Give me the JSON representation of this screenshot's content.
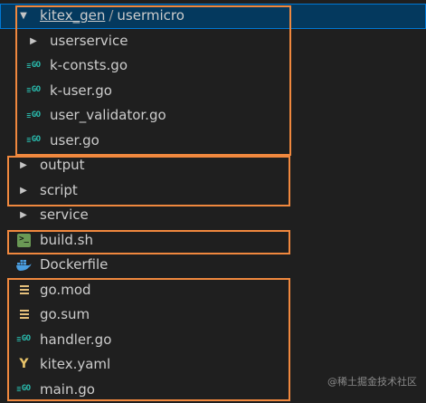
{
  "breadcrumb": {
    "kitex_gen": "kitex_gen",
    "separator": "/",
    "usermicro": "usermicro"
  },
  "tree": {
    "userservice": "userservice",
    "k_consts": "k-consts.go",
    "k_user": "k-user.go",
    "user_validator": "user_validator.go",
    "user_go": "user.go",
    "output": "output",
    "script": "script",
    "service": "service",
    "build_sh": "build.sh",
    "dockerfile": "Dockerfile",
    "go_mod": "go.mod",
    "go_sum": "go.sum",
    "handler_go": "handler.go",
    "kitex_yaml": "kitex.yaml",
    "main_go": "main.go"
  },
  "icons": {
    "go_glyph": "GO",
    "terminal_glyph": ">_",
    "yaml_glyph": "Y",
    "chevron_expanded": "▼",
    "chevron_collapsed": "▶"
  },
  "colors": {
    "highlight": "#f0883e",
    "selection": "#04395e",
    "go": "#29beb0"
  },
  "watermark": "@稀土掘金技术社区"
}
